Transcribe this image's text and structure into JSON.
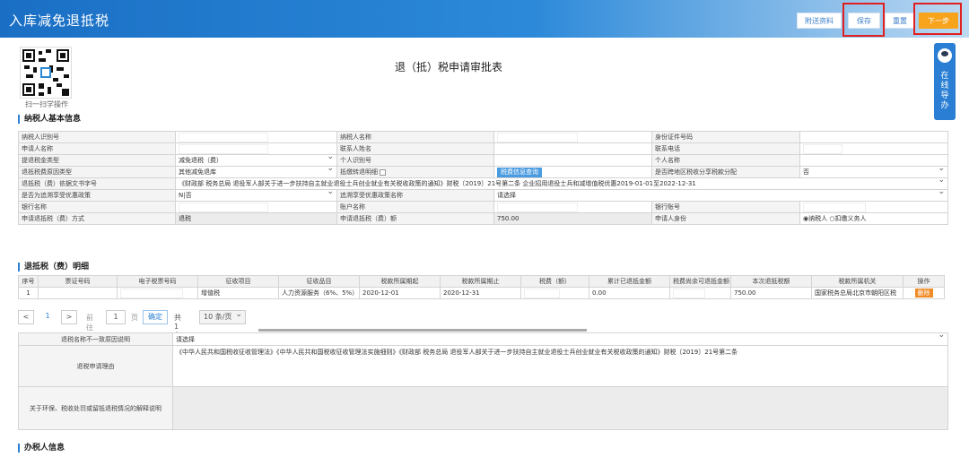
{
  "header": {
    "title": "入库减免退抵税",
    "buttons": {
      "attach": "附送资料",
      "save": "保存",
      "reset": "重置",
      "next": "下一步"
    }
  },
  "qr": {
    "caption": "扫一扫学操作"
  },
  "doc_title": "退（抵）税申请审批表",
  "side_tab": {
    "label": "在线导办"
  },
  "sections": {
    "basic": "纳税人基本信息",
    "detail": "退抵税（费）明细",
    "handler": "办税人信息"
  },
  "basic": {
    "taxpayer_id": "纳税人识别号",
    "taxpayer_name": "纳税人名称",
    "id_no": "身份证件号码",
    "applicant_name": "申请人名称",
    "contact_name": "联系人姓名",
    "contact_phone": "联系电话",
    "tax_type": "提退税金类型",
    "tax_type_val": "减免退税（费）",
    "person_id": "个人识别号",
    "person_name": "个人名称",
    "reason_type": "退抵税费原因类型",
    "reason_type_val": "其他减免退库",
    "offset_detail": "抵缴转退明细",
    "info_query": "税费信息查询",
    "cross_region": "是否跨地区税收分享税款分配",
    "cross_region_val": "否",
    "doc_no": "退抵税（费）依据文书字号",
    "doc_no_val": "《财政部 税务总局 退役军人部关于进一步扶持自主就业退役士兵创业就业有关税收政策的通知》财税〔2019〕21号第二条 企业招用退役士兵和减增值税优惠2019-01-01至2022-12-31",
    "retro_policy": "是否为追溯享受优惠政策",
    "retro_policy_val": "N|否",
    "retro_policy_name": "追溯享受优惠政策名称",
    "retro_policy_name_val": "请选择",
    "bank_name": "银行名称",
    "account_name": "账户名称",
    "bank_account": "银行账号",
    "refund_method": "申请退抵税（费）方式",
    "refund_method_val": "退税",
    "refund_amount": "申请退抵税（费）额",
    "refund_amount_val": "750.00",
    "applicant_identity": "申请人身份",
    "identity_opt1": "纳税人",
    "identity_opt2": "扣缴义务人"
  },
  "detail_table": {
    "headers": [
      "序号",
      "票证号码",
      "电子税票号码",
      "征收项目",
      "征收品目",
      "税款所属期起",
      "税款所属期止",
      "税费（额）",
      "累计已退抵金额",
      "税费尚余可退抵金额",
      "本次退抵税额",
      "税款所属机关",
      "操作"
    ],
    "rows": [
      {
        "no": "1",
        "ticket": "",
        "eticket": "",
        "item": "增值税",
        "subitem": "人力资源服务（6%、5%）",
        "start": "2020-12-01",
        "end": "2020-12-31",
        "tax": "",
        "refunded": "0.00",
        "remaining": "",
        "current": "750.00",
        "office": "国家税务总局北京市朝阳区税",
        "op": "删除"
      }
    ]
  },
  "pager": {
    "prev": "<",
    "page": "1",
    "next": ">",
    "goto_label": "前往",
    "page_input": "1",
    "page_unit": "页",
    "confirm": "确定",
    "total": "共1条",
    "page_size": "10 条/页"
  },
  "reason_section": {
    "mismatch_label": "退税名称不一致原因说明",
    "mismatch_val": "请选择",
    "reason_label": "退税申请理由",
    "reason_text": "《中华人民共和国税收征收管理法》《中华人民共和国税收征收管理法实施细则》《财政部 税务总局 退役军人部关于进一步扶持自主就业退役士兵创业就业有关税收政策的通知》财税〔2019〕21号第二条",
    "env_label": "关于环保、税收处罚或留抵退税情况的解释说明",
    "env_text": ""
  },
  "colors": {
    "header": "#2c89d9",
    "accent": "#f7a31c",
    "highlight": "#e02020"
  }
}
